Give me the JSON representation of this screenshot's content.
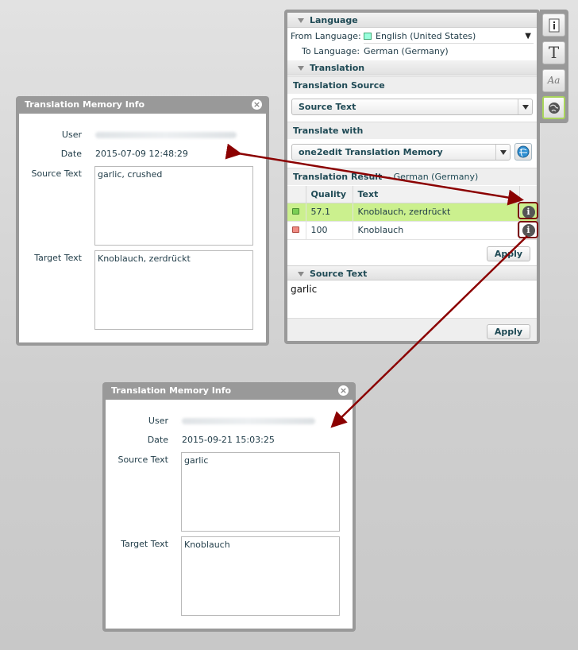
{
  "panel": {
    "language": {
      "header": "Language",
      "from_label": "From Language:",
      "from_value": "English (United States)",
      "to_label": "To Language:",
      "to_value": "German (Germany)"
    },
    "translation": {
      "header": "Translation",
      "source_heading": "Translation Source",
      "source_value": "Source Text",
      "with_heading": "Translate with",
      "with_value": "one2edit Translation Memory",
      "result_heading": "Translation Result",
      "result_lang": "- German (Germany)",
      "columns": [
        "Quality",
        "Text"
      ],
      "rows": [
        {
          "quality": "57.1",
          "text": "Knoblauch, zerdrückt",
          "status": "green"
        },
        {
          "quality": "100",
          "text": "Knoblauch",
          "status": "red"
        }
      ],
      "apply_label": "Apply"
    },
    "source_text": {
      "header": "Source Text",
      "value": "garlic",
      "apply_label": "Apply"
    }
  },
  "dialogs": [
    {
      "title": "Translation Memory Info",
      "user_label": "User",
      "date_label": "Date",
      "date": "2015-07-09 12:48:29",
      "source_label": "Source Text",
      "source": "garlic, crushed",
      "target_label": "Target Text",
      "target": "Knoblauch, zerdrückt"
    },
    {
      "title": "Translation Memory Info",
      "user_label": "User",
      "date_label": "Date",
      "date": "2015-09-21 15:03:25",
      "source_label": "Source Text",
      "source": "garlic",
      "target_label": "Target Text",
      "target": "Knoblauch"
    }
  ],
  "colors": {
    "selected_row": "#cbf08e",
    "annotation_arrow": "#8b0000",
    "active_tool_border": "#a9d55c"
  }
}
